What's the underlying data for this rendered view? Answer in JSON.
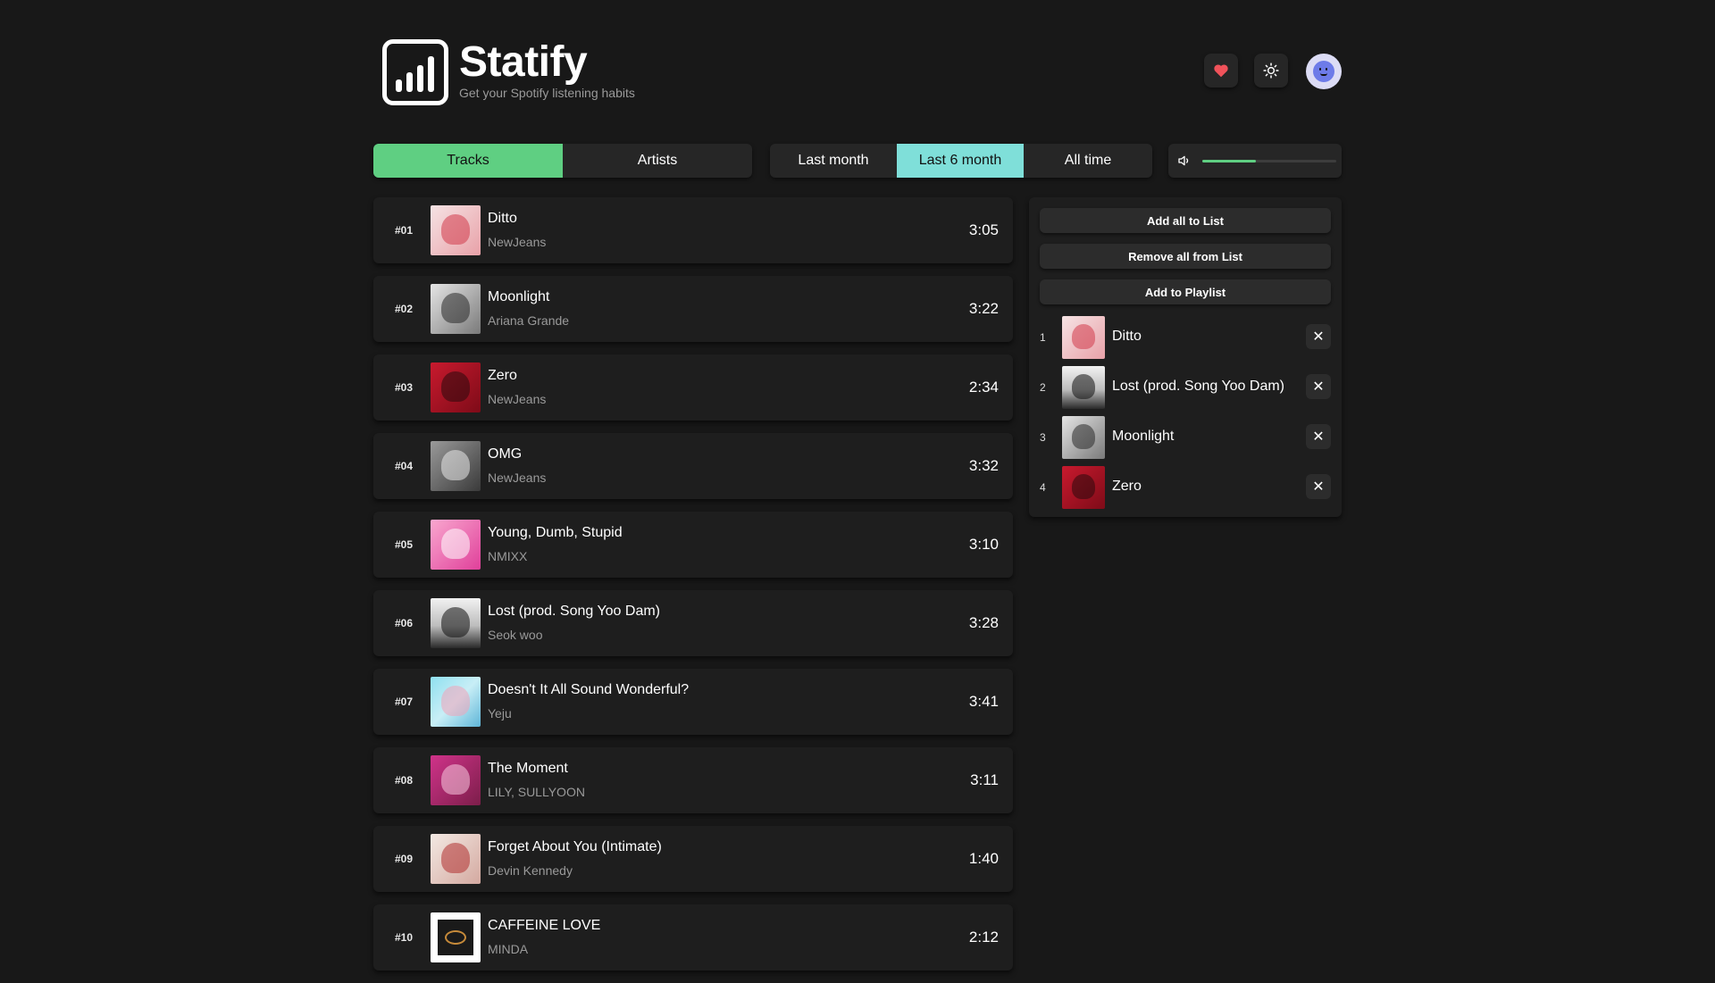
{
  "header": {
    "title": "Statify",
    "subtitle": "Get your Spotify listening habits",
    "heart_icon_color": "#f0525a"
  },
  "type_tabs": [
    {
      "label": "Tracks",
      "active": true
    },
    {
      "label": "Artists",
      "active": false
    }
  ],
  "range_tabs": [
    {
      "label": "Last month",
      "active": false
    },
    {
      "label": "Last 6 month",
      "active": true
    },
    {
      "label": "All time",
      "active": false
    }
  ],
  "volume": {
    "level": 0.4
  },
  "tracks": [
    {
      "rank": "#01",
      "name": "Ditto",
      "artist": "NewJeans",
      "duration": "3:05",
      "cover": "ditto"
    },
    {
      "rank": "#02",
      "name": "Moonlight",
      "artist": "Ariana Grande",
      "duration": "3:22",
      "cover": "moonlight"
    },
    {
      "rank": "#03",
      "name": "Zero",
      "artist": "NewJeans",
      "duration": "2:34",
      "cover": "zero"
    },
    {
      "rank": "#04",
      "name": "OMG",
      "artist": "NewJeans",
      "duration": "3:32",
      "cover": "omg"
    },
    {
      "rank": "#05",
      "name": "Young, Dumb, Stupid",
      "artist": "NMIXX",
      "duration": "3:10",
      "cover": "nmixx"
    },
    {
      "rank": "#06",
      "name": "Lost (prod. Song Yoo Dam)",
      "artist": "Seok woo",
      "duration": "3:28",
      "cover": "lost"
    },
    {
      "rank": "#07",
      "name": "Doesn't It All Sound Wonderful?",
      "artist": "Yeju",
      "duration": "3:41",
      "cover": "yeju"
    },
    {
      "rank": "#08",
      "name": "The Moment",
      "artist": "LILY, SULLYOON",
      "duration": "3:11",
      "cover": "moment"
    },
    {
      "rank": "#09",
      "name": "Forget About You (Intimate)",
      "artist": "Devin Kennedy",
      "duration": "1:40",
      "cover": "forget"
    },
    {
      "rank": "#10",
      "name": "CAFFEINE LOVE",
      "artist": "MINDA",
      "duration": "2:12",
      "cover": "caffeine"
    }
  ],
  "panel": {
    "add_all_label": "Add all to List",
    "remove_all_label": "Remove all from List",
    "add_playlist_label": "Add to Playlist",
    "queue": [
      {
        "num": "1",
        "name": "Ditto",
        "cover": "ditto"
      },
      {
        "num": "2",
        "name": "Lost (prod. Song Yoo Dam)",
        "cover": "lost"
      },
      {
        "num": "3",
        "name": "Moonlight",
        "cover": "moonlight"
      },
      {
        "num": "4",
        "name": "Zero",
        "cover": "zero"
      }
    ],
    "remove_symbol": "✕"
  }
}
